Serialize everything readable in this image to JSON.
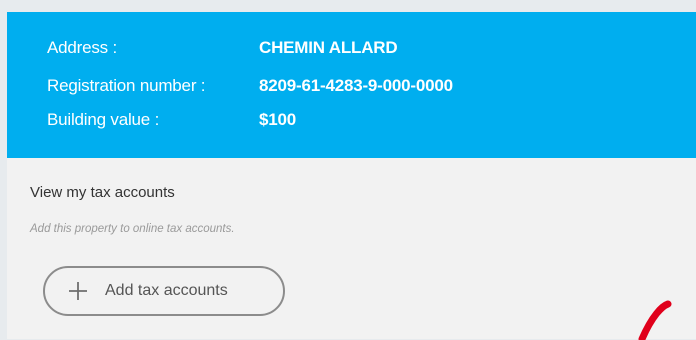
{
  "property": {
    "address_label": "Address :",
    "address_value": "CHEMIN ALLARD",
    "registration_label": "Registration number :",
    "registration_value": "8209-61-4283-9-000-0000",
    "building_label": "Building value :",
    "building_value": "$100"
  },
  "tax": {
    "title": "View my tax accounts",
    "subtitle": "Add this property to online tax accounts.",
    "add_button_label": "Add tax accounts",
    "add_button_icon": "plus-icon"
  },
  "colors": {
    "header_bg": "#00aeef",
    "page_bg": "#e7ebee",
    "card_bg": "#f2f2f2",
    "annotation_mark": "#e0001b"
  }
}
